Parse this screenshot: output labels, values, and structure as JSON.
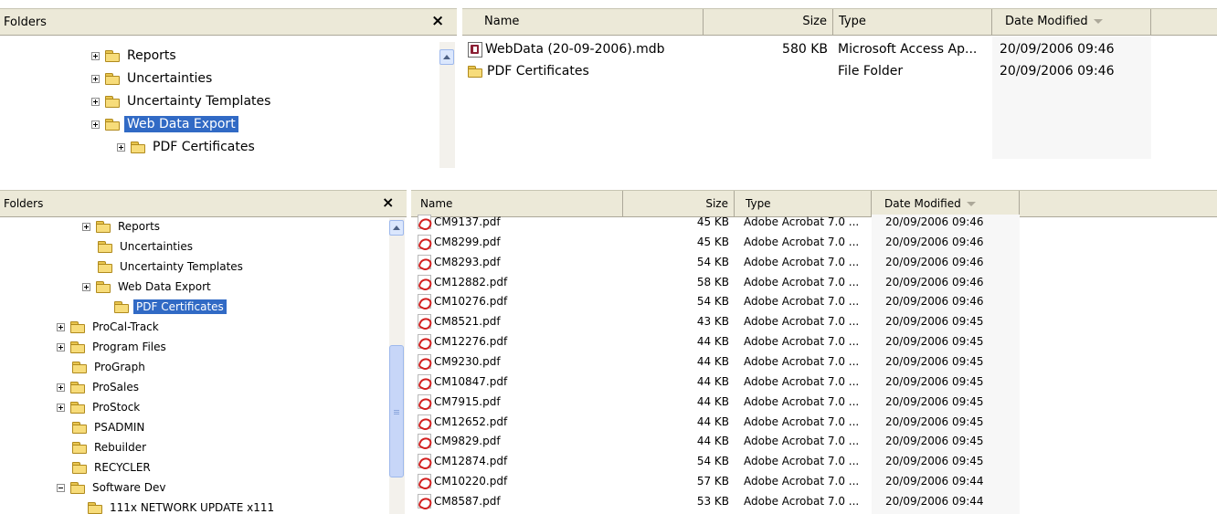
{
  "top": {
    "folders_label": "Folders",
    "close_glyph": "×",
    "columns": {
      "name": "Name",
      "size": "Size",
      "type": "Type",
      "date": "Date Modified"
    },
    "tree": [
      {
        "label": "Reports",
        "expander": "plus",
        "selected": false
      },
      {
        "label": "Uncertainties",
        "expander": "plus",
        "selected": false
      },
      {
        "label": "Uncertainty Templates",
        "expander": "plus",
        "selected": false
      },
      {
        "label": "Web Data Export",
        "expander": "plus",
        "selected": true
      },
      {
        "label": "PDF Certificates",
        "expander": "plus",
        "selected": false
      }
    ],
    "files": [
      {
        "name": "WebData (20-09-2006).mdb",
        "icon": "access-database-icon",
        "size": "580 KB",
        "type": "Microsoft Access Ap...",
        "date": "20/09/2006 09:46"
      },
      {
        "name": "PDF Certificates",
        "icon": "folder-icon",
        "size": "",
        "type": "File Folder",
        "date": "20/09/2006 09:46"
      }
    ]
  },
  "bottom": {
    "folders_label": "Folders",
    "close_glyph": "×",
    "columns": {
      "name": "Name",
      "size": "Size",
      "type": "Type",
      "date": "Date Modified"
    },
    "tree": [
      {
        "label": "Reports",
        "expander": "plus",
        "selected": false
      },
      {
        "label": "Uncertainties",
        "expander": "none",
        "selected": false
      },
      {
        "label": "Uncertainty Templates",
        "expander": "none",
        "selected": false
      },
      {
        "label": "Web Data Export",
        "expander": "plus",
        "selected": false
      },
      {
        "label": "PDF Certificates",
        "expander": "none",
        "selected": true
      },
      {
        "label": "ProCal-Track",
        "expander": "plus",
        "selected": false
      },
      {
        "label": "Program Files",
        "expander": "plus",
        "selected": false
      },
      {
        "label": "ProGraph",
        "expander": "none",
        "selected": false
      },
      {
        "label": "ProSales",
        "expander": "plus",
        "selected": false
      },
      {
        "label": "ProStock",
        "expander": "plus",
        "selected": false
      },
      {
        "label": "PSADMIN",
        "expander": "none",
        "selected": false
      },
      {
        "label": "Rebuilder",
        "expander": "none",
        "selected": false
      },
      {
        "label": "RECYCLER",
        "expander": "none",
        "selected": false
      },
      {
        "label": "Software Dev",
        "expander": "minus",
        "selected": false
      },
      {
        "label": "111x NETWORK UPDATE x111",
        "expander": "none",
        "selected": false
      }
    ],
    "files": [
      {
        "name": "CM9137.pdf",
        "size": "45 KB",
        "type": "Adobe Acrobat 7.0 ...",
        "date": "20/09/2006 09:46"
      },
      {
        "name": "CM8299.pdf",
        "size": "45 KB",
        "type": "Adobe Acrobat 7.0 ...",
        "date": "20/09/2006 09:46"
      },
      {
        "name": "CM8293.pdf",
        "size": "54 KB",
        "type": "Adobe Acrobat 7.0 ...",
        "date": "20/09/2006 09:46"
      },
      {
        "name": "CM12882.pdf",
        "size": "58 KB",
        "type": "Adobe Acrobat 7.0 ...",
        "date": "20/09/2006 09:46"
      },
      {
        "name": "CM10276.pdf",
        "size": "54 KB",
        "type": "Adobe Acrobat 7.0 ...",
        "date": "20/09/2006 09:46"
      },
      {
        "name": "CM8521.pdf",
        "size": "43 KB",
        "type": "Adobe Acrobat 7.0 ...",
        "date": "20/09/2006 09:45"
      },
      {
        "name": "CM12276.pdf",
        "size": "44 KB",
        "type": "Adobe Acrobat 7.0 ...",
        "date": "20/09/2006 09:45"
      },
      {
        "name": "CM9230.pdf",
        "size": "44 KB",
        "type": "Adobe Acrobat 7.0 ...",
        "date": "20/09/2006 09:45"
      },
      {
        "name": "CM10847.pdf",
        "size": "44 KB",
        "type": "Adobe Acrobat 7.0 ...",
        "date": "20/09/2006 09:45"
      },
      {
        "name": "CM7915.pdf",
        "size": "44 KB",
        "type": "Adobe Acrobat 7.0 ...",
        "date": "20/09/2006 09:45"
      },
      {
        "name": "CM12652.pdf",
        "size": "44 KB",
        "type": "Adobe Acrobat 7.0 ...",
        "date": "20/09/2006 09:45"
      },
      {
        "name": "CM9829.pdf",
        "size": "44 KB",
        "type": "Adobe Acrobat 7.0 ...",
        "date": "20/09/2006 09:45"
      },
      {
        "name": "CM12874.pdf",
        "size": "54 KB",
        "type": "Adobe Acrobat 7.0 ...",
        "date": "20/09/2006 09:45"
      },
      {
        "name": "CM10220.pdf",
        "size": "57 KB",
        "type": "Adobe Acrobat 7.0 ...",
        "date": "20/09/2006 09:44"
      },
      {
        "name": "CM8587.pdf",
        "size": "53 KB",
        "type": "Adobe Acrobat 7.0 ...",
        "date": "20/09/2006 09:44"
      }
    ]
  }
}
